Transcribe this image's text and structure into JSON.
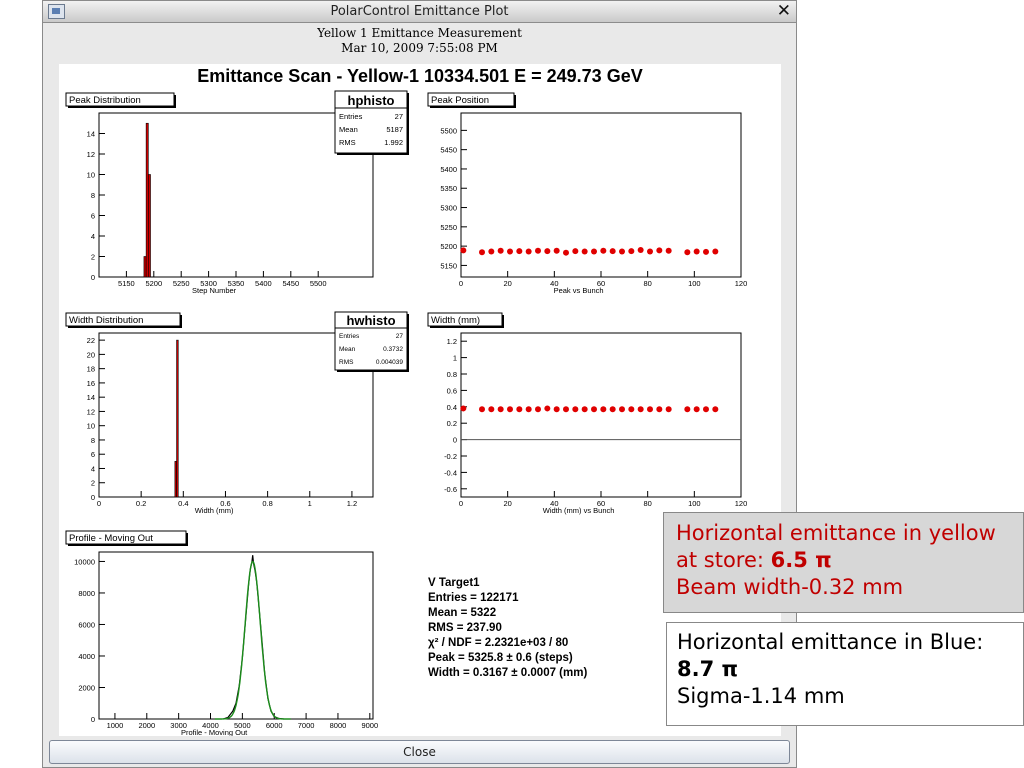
{
  "window": {
    "title": "PolarControl Emittance Plot",
    "close_icon_glyph": "✕",
    "heading_line1": "Yellow 1 Emittance Measurement",
    "heading_line2": "Mar 10, 2009 7:55:08 PM",
    "close_button_label": "Close"
  },
  "plot": {
    "main_title": "Emittance Scan - Yellow-1 10334.501 E = 249.73 GeV",
    "peak_distribution": {
      "title": "Peak Distribution",
      "stats_name": "hphisto",
      "entries_label": "Entries",
      "entries_value": "27",
      "mean_label": "Mean",
      "mean_value": "5187",
      "rms_label": "RMS",
      "rms_value": "1.992"
    },
    "peak_position": {
      "title": "Peak Position"
    },
    "width_distribution": {
      "title": "Width Distribution",
      "stats_name": "hwhisto",
      "entries_label": "Entries",
      "entries_value": "27",
      "mean_label": "Mean",
      "mean_value": "0.3732",
      "rms_label": "RMS",
      "rms_value": "0.004039"
    },
    "width_mm": {
      "title": "Width (mm)"
    },
    "profile": {
      "title": "Profile - Moving Out"
    },
    "fit_stats": {
      "line1": "V Target1",
      "line2": "Entries = 122171",
      "line3": "Mean =    5322",
      "line4": "RMS =  237.90",
      "line5": "χ² / NDF =  2.2321e+03 / 80",
      "line6": "Peak =   5325.8 ±     0.6 (steps)",
      "line7": "Width =   0.3167 ±  0.0007 (mm)"
    }
  },
  "chart_data": [
    {
      "type": "bar",
      "name": "Peak Distribution",
      "xlabel": "Step Number",
      "xlim": [
        5100,
        5600
      ],
      "ylim": [
        0,
        16
      ],
      "x_ticks": [
        5150,
        5200,
        5250,
        5300,
        5350,
        5400,
        5450,
        5500
      ],
      "y_ticks": [
        0,
        2,
        4,
        6,
        8,
        10,
        12,
        14
      ],
      "bins": [
        {
          "x0": 5182,
          "x1": 5186,
          "count": 2
        },
        {
          "x0": 5186,
          "x1": 5190,
          "count": 15
        },
        {
          "x0": 5190,
          "x1": 5194,
          "count": 10
        }
      ],
      "color": "#cc0000"
    },
    {
      "type": "scatter",
      "name": "Peak Position",
      "xlabel": "Peak vs Bunch",
      "xlim": [
        0,
        120
      ],
      "ylim": [
        5120,
        5545
      ],
      "x_ticks": [
        0,
        20,
        40,
        60,
        80,
        100,
        120
      ],
      "y_ticks": [
        5150,
        5200,
        5250,
        5300,
        5350,
        5400,
        5450,
        5500
      ],
      "x": [
        1,
        9,
        13,
        17,
        21,
        25,
        29,
        33,
        37,
        41,
        45,
        49,
        53,
        57,
        61,
        65,
        69,
        73,
        77,
        81,
        85,
        89,
        97,
        101,
        105,
        109
      ],
      "y": [
        5189,
        5184,
        5186,
        5188,
        5186,
        5187,
        5186,
        5188,
        5187,
        5188,
        5183,
        5187,
        5186,
        5186,
        5188,
        5187,
        5186,
        5187,
        5190,
        5186,
        5189,
        5188,
        5184,
        5186,
        5185,
        5186
      ],
      "color": "#e00000"
    },
    {
      "type": "bar",
      "name": "Width Distribution",
      "xlabel": "Width (mm)",
      "xlim": [
        0,
        1.3
      ],
      "ylim": [
        0,
        23
      ],
      "x_ticks": [
        0,
        0.2,
        0.4,
        0.6,
        0.8,
        1,
        1.2
      ],
      "y_ticks": [
        0,
        2,
        4,
        6,
        8,
        10,
        12,
        14,
        16,
        18,
        20,
        22
      ],
      "bins": [
        {
          "x0": 0.36,
          "x1": 0.368,
          "count": 5
        },
        {
          "x0": 0.368,
          "x1": 0.376,
          "count": 22
        }
      ],
      "color": "#cc0000"
    },
    {
      "type": "scatter",
      "name": "Width (mm)",
      "xlabel": "Width (mm) vs Bunch",
      "xlim": [
        0,
        120
      ],
      "ylim": [
        -0.7,
        1.3
      ],
      "x_ticks": [
        0,
        20,
        40,
        60,
        80,
        100,
        120
      ],
      "y_ticks": [
        -0.6,
        -0.4,
        -0.2,
        0,
        0.2,
        0.4,
        0.6,
        0.8,
        1,
        1.2
      ],
      "zero_line": true,
      "x": [
        1,
        9,
        13,
        17,
        21,
        25,
        29,
        33,
        37,
        41,
        45,
        49,
        53,
        57,
        61,
        65,
        69,
        73,
        77,
        81,
        85,
        89,
        97,
        101,
        105,
        109
      ],
      "y": [
        0.38,
        0.37,
        0.37,
        0.37,
        0.37,
        0.37,
        0.37,
        0.37,
        0.38,
        0.37,
        0.37,
        0.37,
        0.37,
        0.37,
        0.37,
        0.37,
        0.37,
        0.37,
        0.37,
        0.37,
        0.37,
        0.37,
        0.37,
        0.37,
        0.37,
        0.37
      ],
      "color": "#e00000"
    },
    {
      "type": "line",
      "name": "Profile - Moving Out",
      "xlabel": "Profile - Moving Out",
      "xlim": [
        500,
        9100
      ],
      "ylim": [
        0,
        10600
      ],
      "x_ticks": [
        1000,
        2000,
        3000,
        4000,
        5000,
        6000,
        7000,
        8000,
        9000
      ],
      "y_ticks": [
        0,
        2000,
        4000,
        6000,
        8000,
        10000
      ],
      "peak": 5325.8,
      "sigma": 237.9,
      "amplitude": 10000,
      "x": [
        4400,
        4550,
        4700,
        4800,
        4900,
        5000,
        5100,
        5150,
        5200,
        5250,
        5300,
        5325,
        5350,
        5400,
        5450,
        5500,
        5600,
        5700,
        5800,
        5900,
        6000,
        6150,
        6300
      ],
      "y": [
        0,
        100,
        500,
        1000,
        2100,
        3900,
        6300,
        7500,
        8600,
        9500,
        9950,
        10400,
        9900,
        9400,
        8700,
        7600,
        5300,
        2900,
        1300,
        500,
        150,
        30,
        0
      ],
      "colors": {
        "data": "#000000",
        "fit": "#1b8c1b"
      }
    }
  ],
  "annotations": {
    "yellow_box": {
      "line1": "Horizontal emittance in yellow",
      "line2_prefix": "at store: ",
      "line2_value": "6.5 π",
      "line3": "Beam width-0.32 mm"
    },
    "blue_box": {
      "line1": "Horizontal emittance in Blue:",
      "line2_value": "8.7 π",
      "line3": "Sigma-1.14 mm"
    }
  }
}
